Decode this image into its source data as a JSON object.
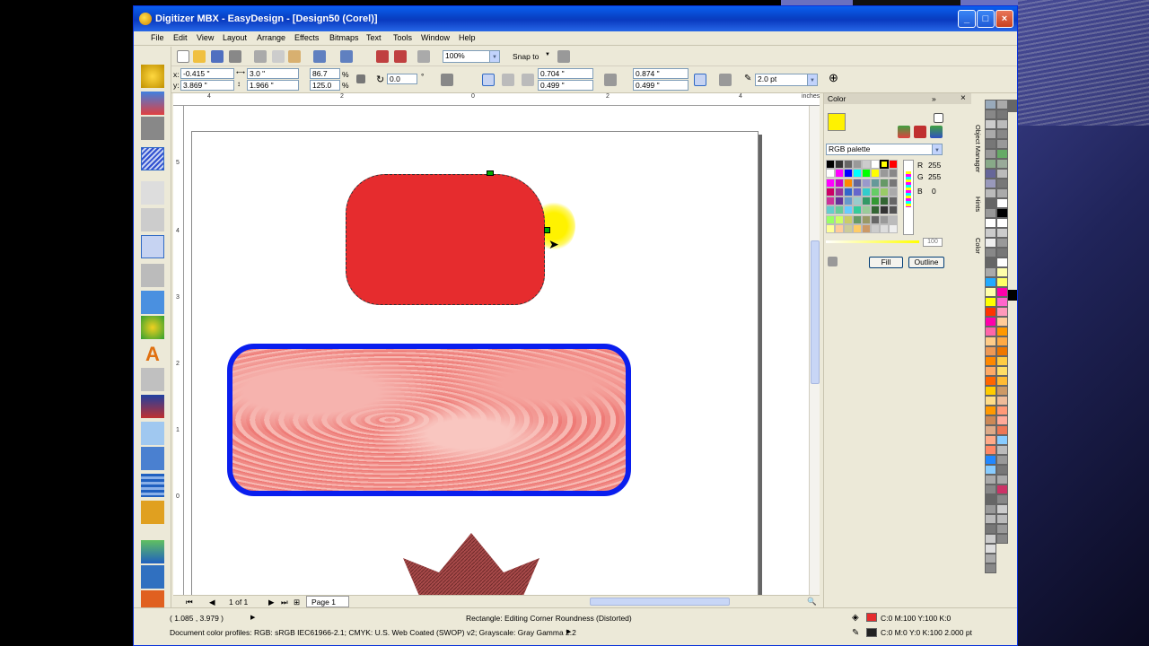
{
  "window": {
    "title": "Digitizer MBX - EasyDesign - [Design50 (Corel)]",
    "min": "_",
    "max": "□",
    "close": "×"
  },
  "menu": [
    "File",
    "Edit",
    "View",
    "Layout",
    "Arrange",
    "Effects",
    "Bitmaps",
    "Text",
    "Tools",
    "Window",
    "Help"
  ],
  "toolbar1": {
    "zoom": "100%",
    "snap_label": "Snap to"
  },
  "propbar": {
    "x": "-0.415 \"",
    "y": "3.869 \"",
    "w": "3.0 \"",
    "h": "1.966 \"",
    "scale_x": "86.7",
    "scale_y": "125.0",
    "angle": "0.0",
    "corner_a": "0.704 \"",
    "corner_b": "0.499 \"",
    "corner_c": "0.874 \"",
    "corner_d": "0.499 \"",
    "outline": "2.0 pt"
  },
  "ruler_h": [
    "4",
    "2",
    "0",
    "2",
    "4",
    "inches"
  ],
  "ruler_v": [
    "5",
    "4",
    "3",
    "2",
    "1",
    "0"
  ],
  "pagebar": {
    "counter": "1 of 1",
    "page_tab": "Page 1"
  },
  "docker": {
    "title": "Color",
    "palette_name": "RGB palette",
    "r_label": "R",
    "r_value": "255",
    "g_label": "G",
    "g_value": "255",
    "b_label": "B",
    "b_value": "0",
    "slider_value": "100",
    "fill_btn": "Fill",
    "outline_btn": "Outline"
  },
  "side_tabs": [
    "Object Manager",
    "Hints",
    "Color"
  ],
  "status": {
    "coords": "( 1.085 , 3.979 )",
    "message": "Rectangle: Editing Corner Roundness (Distorted)",
    "profiles": "Document color profiles: RGB: sRGB IEC61966-2.1; CMYK: U.S. Web Coated (SWOP) v2; Grayscale: Gray Gamma 2.2",
    "fill_info": "C:0 M:100 Y:100 K:0",
    "outline_info": "C:0 M:0 Y:0 K:100  2.000 pt"
  },
  "colors": {
    "accent": "#0a5ff0",
    "shape_fill": "#e62c2e",
    "outline_blue": "#0a1eee",
    "selected_color": "#fff200"
  }
}
